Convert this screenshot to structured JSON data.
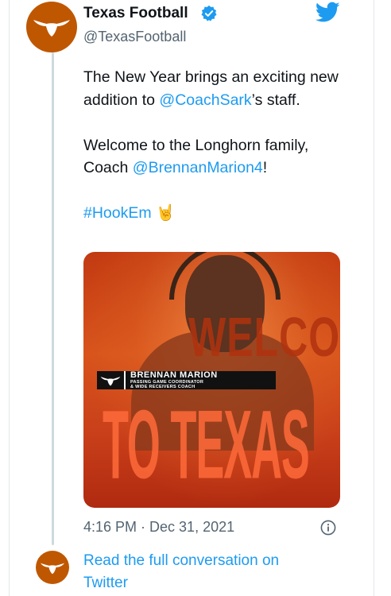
{
  "colors": {
    "brand": "#bf5700",
    "link": "#1d9bf0",
    "verified": "#1d9bf0",
    "muted": "#536471",
    "text": "#0f1419"
  },
  "account": {
    "display_name": "Texas Football",
    "handle": "@TexasFootball",
    "avatar_icon": "longhorn-logo-icon",
    "verified_icon": "verified-badge-icon"
  },
  "platform_icon": "twitter-bird-icon",
  "tweet": {
    "line1_text": "The New Year brings an exciting new addition to ",
    "line1_mention": "@CoachSark",
    "line1_suffix": "’s staff.",
    "line2_text": "Welcome to the Longhorn family, Coach ",
    "line2_mention": "@BrennanMarion4",
    "line2_suffix": "!",
    "hashtag": "#HookEm",
    "emoji": "🤘"
  },
  "media": {
    "overlay_title_top": "WELCOME",
    "overlay_title_bottom": "TO TEXAS",
    "coach_name": "BRENNAN MARION",
    "coach_role_line1": "PASSING GAME COORDINATOR",
    "coach_role_line2": "& WIDE RECEIVERS COACH"
  },
  "timestamp": "4:16 PM · Dec 31, 2021",
  "info_icon": "info-icon",
  "read_more": "Read the full conversation on Twitter"
}
